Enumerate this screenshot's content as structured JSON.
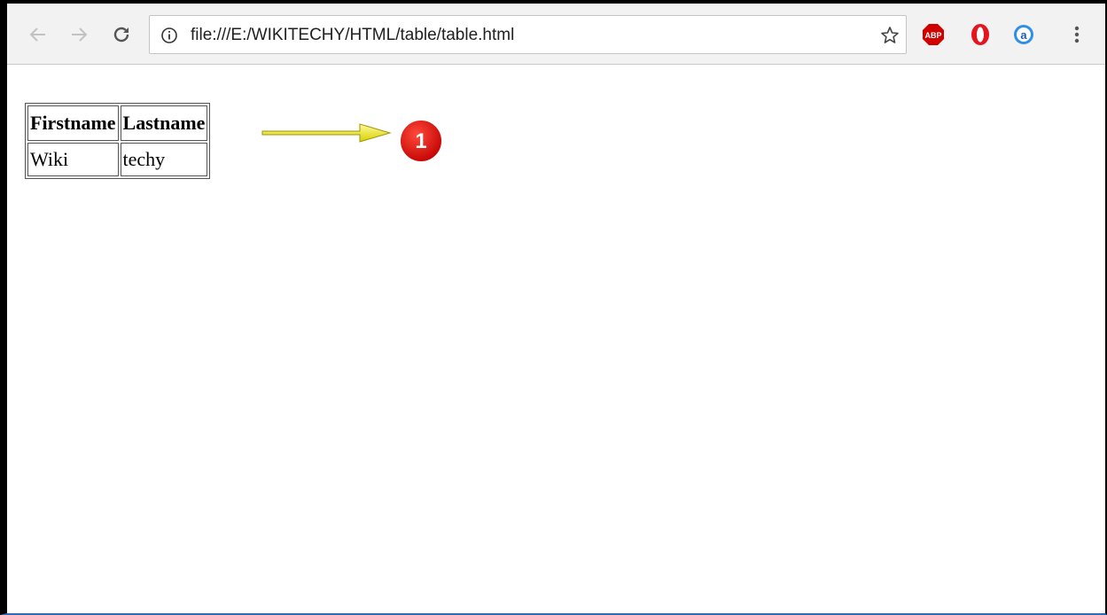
{
  "browser": {
    "url": "file:///E:/WIKITECHY/HTML/table/table.html",
    "icons": {
      "back": "back-arrow-icon",
      "forward": "forward-arrow-icon",
      "reload": "reload-icon",
      "info": "info-icon",
      "bookmark": "star-icon",
      "adblock": "adblock-icon",
      "opera": "opera-icon",
      "amazon": "amazon-assistant-icon",
      "menu": "menu-dots-icon"
    },
    "extensions": {
      "adblock_label": "ABP",
      "amazon_label": "a"
    }
  },
  "page": {
    "table": {
      "headers": [
        "Firstname",
        "Lastname"
      ],
      "rows": [
        [
          "Wiki",
          "techy"
        ]
      ]
    },
    "annotation": {
      "marker": "1",
      "arrow_color": "#e8e400",
      "badge_color": "#e00000"
    }
  }
}
